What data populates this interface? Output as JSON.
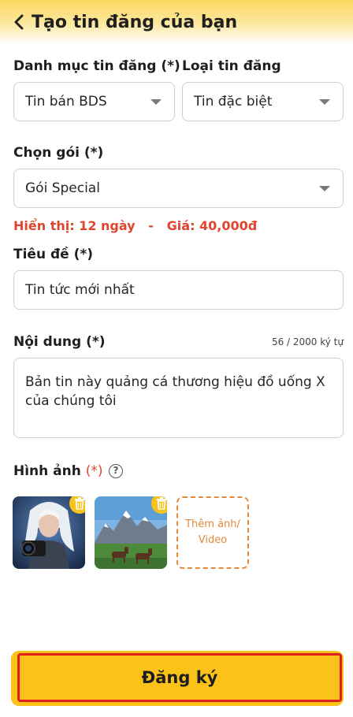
{
  "header": {
    "title": "Tạo tin đăng của bạn"
  },
  "category": {
    "label": "Danh mục tin đăng (*)",
    "value": "Tin bán BDS"
  },
  "post_type": {
    "label": "Loại tin đăng",
    "value": "Tin đặc biệt"
  },
  "package": {
    "label": "Chọn gói (*)",
    "value": "Gói Special"
  },
  "package_info": {
    "text": "Hiển thị: 12 ngày   -   Giá: 40,000đ"
  },
  "title_field": {
    "label": "Tiêu đề (*)",
    "value": "Tin tức mới nhất"
  },
  "content_field": {
    "label": "Nội dung (*)",
    "counter": "56 / 2000 ký tự",
    "value": "Bản tin này quảng cá thương hiệu đồ uống X của chúng tôi"
  },
  "images": {
    "label": "Hình ảnh",
    "required_mark": "(*)",
    "help_symbol": "?",
    "add_label": "Thêm ảnh/ Video",
    "items": [
      "warrior-photo",
      "mountain-horses-photo"
    ]
  },
  "submit": {
    "label": "Đăng ký"
  },
  "colors": {
    "accent": "#fbc21a",
    "alert": "#e0452f",
    "dashed": "#e08a3a"
  }
}
